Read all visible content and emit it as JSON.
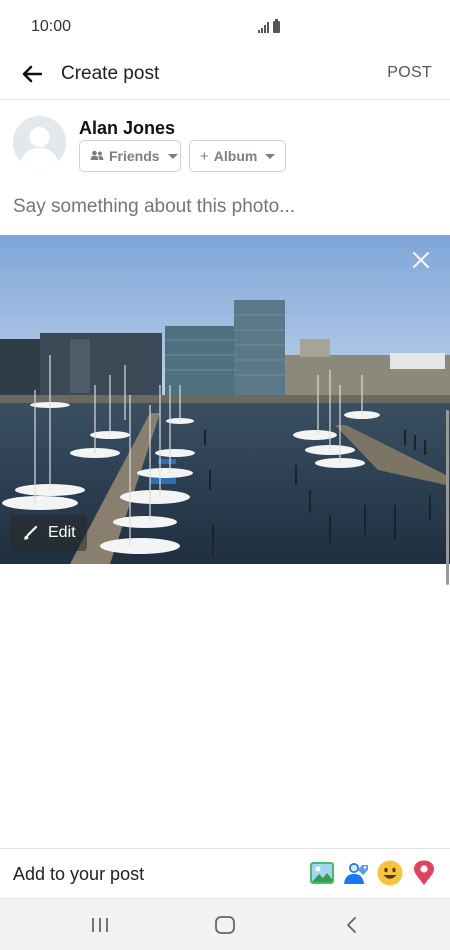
{
  "status_bar": {
    "time": "10:00",
    "icons": [
      "signal-icon",
      "battery-icon"
    ]
  },
  "app_bar": {
    "title": "Create post",
    "post_label": "POST",
    "back_icon": "back-arrow-icon"
  },
  "composer": {
    "user_name": "Alan Jones",
    "privacy_label": "Friends",
    "album_label": "Album",
    "album_prefix": "+",
    "caption_placeholder": "Say something about this photo..."
  },
  "photo": {
    "edit_label": "Edit",
    "close_icon": "close-icon",
    "edit_icon": "brush-icon"
  },
  "add_to_post": {
    "label": "Add to your post",
    "icons": [
      "photo-icon",
      "tag-people-icon",
      "feeling-emoji-icon",
      "location-pin-icon"
    ]
  },
  "nav_bar": {
    "buttons": [
      "recents-icon",
      "home-icon",
      "back-icon"
    ]
  },
  "colors": {
    "accent_blue": "#1877f2",
    "pin_red": "#e4405f",
    "emoji_yellow": "#f7c43d"
  }
}
